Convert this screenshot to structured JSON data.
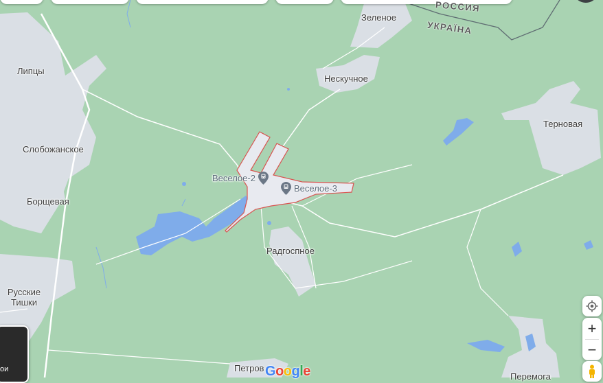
{
  "colors": {
    "land": "#a9d3b2",
    "urban": "#dadfe5",
    "water": "#7facea",
    "road": "#ffffff",
    "border": "#5f6c72",
    "highlight": "#e8eaf0",
    "highlight_outline": "#d9534f"
  },
  "map": {
    "border_labels": {
      "russia": "РОССИЯ",
      "ukraine": "УКРАЇНА"
    },
    "places": {
      "zelenoe": "Зеленое",
      "neskuchnoe": "Нескучное",
      "lipcy": "Липцы",
      "slobozhanskoe": "Слобожанское",
      "borshchevaya": "Борщевая",
      "ternovaya": "Терновая",
      "radgospnoe": "Радгоспное",
      "russkie_tishki": "Русские\nТишки",
      "petrov": "Петров",
      "peremoga": "Перемога"
    },
    "pois": {
      "veseloe2": "Веселое-2",
      "veseloe3": "Веселое-3"
    },
    "poi_icon": "train-station-pin-icon"
  },
  "controls": {
    "my_location_icon": "my-location-icon",
    "zoom_in": "+",
    "zoom_out": "−",
    "pegman_icon": "pegman-icon",
    "layers_label": "ои"
  },
  "brand": {
    "logo": "Google"
  }
}
